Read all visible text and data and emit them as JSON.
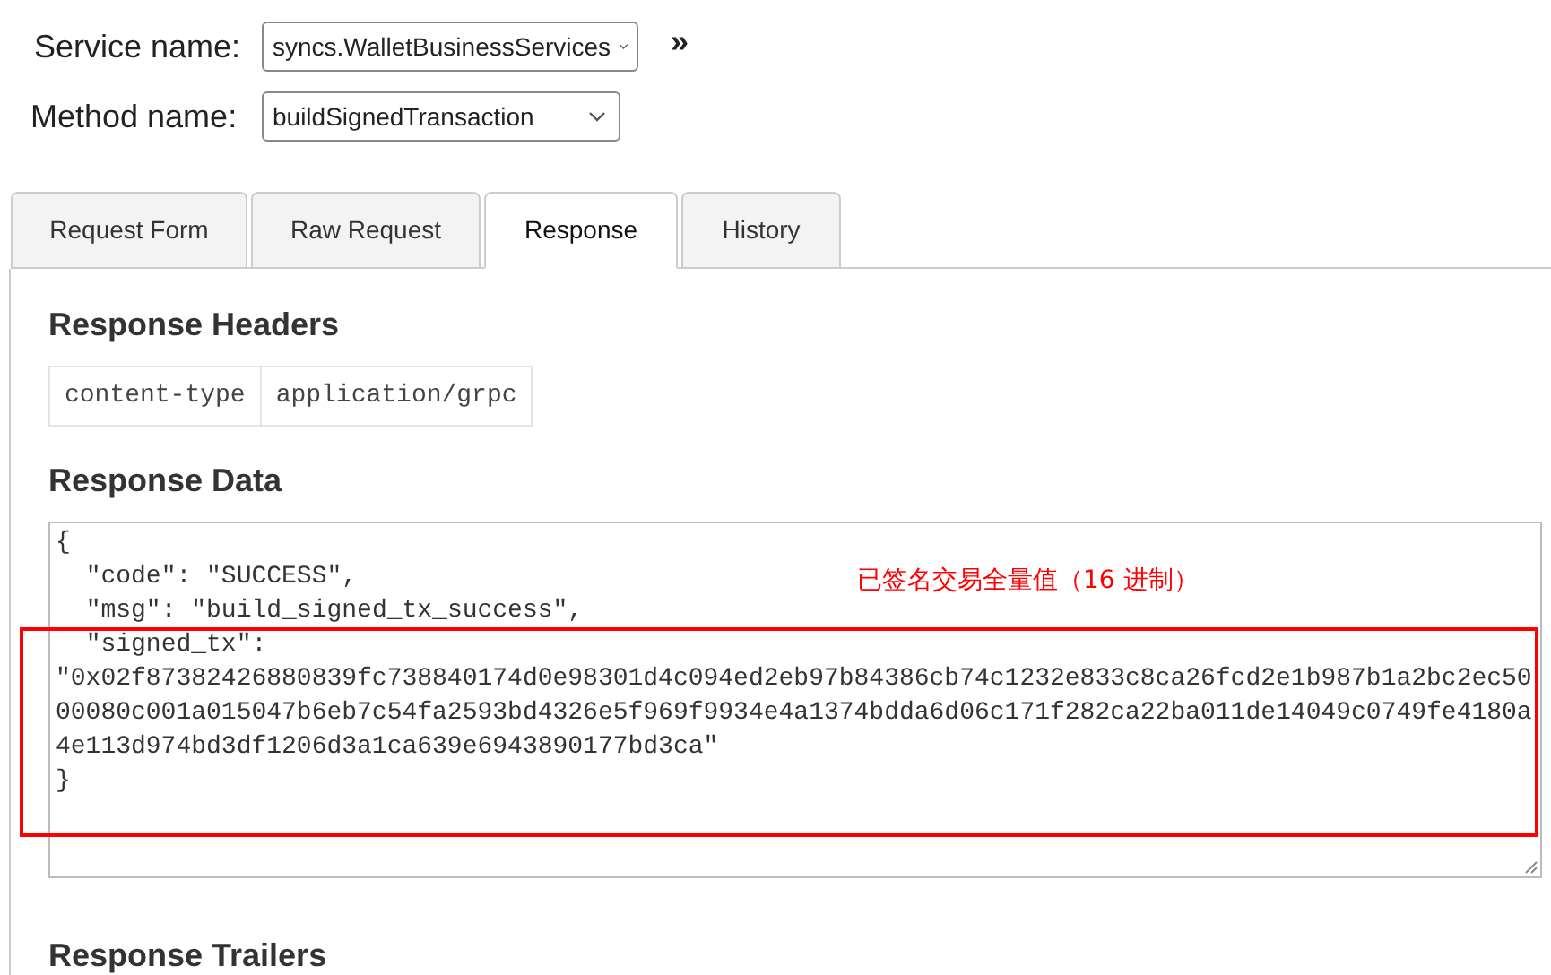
{
  "service": {
    "label": "Service name:",
    "value": "syncs.WalletBusinessServices",
    "more": "»"
  },
  "method": {
    "label": "Method name:",
    "value": "buildSignedTransaction"
  },
  "tabs": [
    {
      "label": "Request Form",
      "selected": false
    },
    {
      "label": "Raw Request",
      "selected": false
    },
    {
      "label": "Response",
      "selected": true
    },
    {
      "label": "History",
      "selected": false
    }
  ],
  "response_headers": {
    "title": "Response Headers",
    "rows": [
      {
        "name": "content-type",
        "value": "application/grpc"
      }
    ]
  },
  "response_data": {
    "title": "Response Data",
    "value": "{\n  \"code\": \"SUCCESS\",\n  \"msg\": \"build_signed_tx_success\",\n  \"signed_tx\":\n\"0x02f87382426880839fc738840174d0e98301d4c094ed2eb97b84386cb74c1232e833c8ca26fcd2e1b987b1a2bc2ec5000080c001a015047b6eb7c54fa2593bd4326e5f969f9934e4a1374bdda6d06c171f282ca22ba011de14049c0749fe4180a4e113d974bd3df1206d3a1ca639e6943890177bd3ca\"\n}"
  },
  "annotation": {
    "label": "已签名交易全量值（16 进制）"
  },
  "response_trailers": {
    "title": "Response Trailers"
  }
}
